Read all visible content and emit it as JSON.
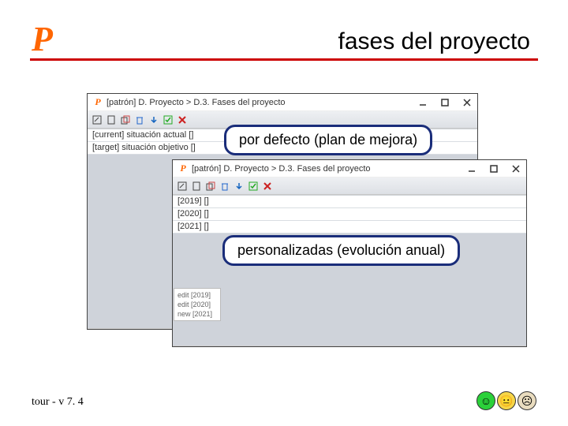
{
  "header": {
    "logo_text": "P",
    "title": "fases del proyecto"
  },
  "callouts": {
    "default_label": "por defecto (plan de mejora)",
    "custom_label": "personalizadas (evolución anual)"
  },
  "window_back": {
    "title": "[patrón] D. Proyecto > D.3. Fases del proyecto",
    "lines": [
      "[current] situación actual []",
      "[target] situación objetivo []"
    ]
  },
  "window_front": {
    "title": "[patrón] D. Proyecto > D.3. Fases del proyecto",
    "lines": [
      "[2019]  []",
      "[2020]  []",
      "[2021]  []"
    ]
  },
  "history": {
    "rows": [
      "edit  [2019]",
      "edit  [2020]",
      "new  [2021]"
    ]
  },
  "footer": {
    "version": "tour - v 7. 4"
  },
  "toolbar_icons": [
    "edit-icon",
    "new-icon",
    "copy-icon",
    "delete-icon",
    "down-icon",
    "direct-icon",
    "close-icon"
  ]
}
